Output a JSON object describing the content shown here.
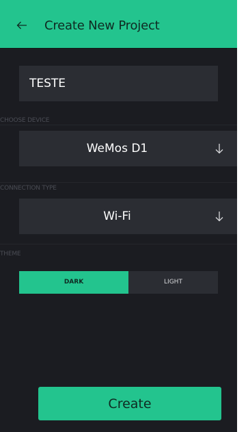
{
  "header": {
    "title": "Create New Project",
    "back_icon": "arrow-left-icon"
  },
  "project_name": {
    "value": "TESTE"
  },
  "device": {
    "label": "CHOOSE DEVICE",
    "value": "WeMos D1",
    "icon": "arrow-down-icon"
  },
  "connection": {
    "label": "CONNECTION TYPE",
    "value": "Wi-Fi",
    "icon": "arrow-down-icon"
  },
  "theme": {
    "label": "THEME",
    "options": [
      "DARK",
      "LIGHT"
    ],
    "selected": "DARK"
  },
  "create_button": {
    "label": "Create"
  },
  "colors": {
    "accent": "#23c48e",
    "background": "#1b1c21",
    "field": "#2b2d33",
    "label": "#4a4c54"
  }
}
